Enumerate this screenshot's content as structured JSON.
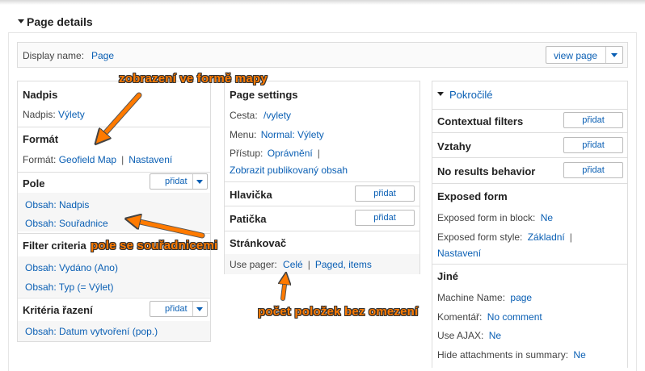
{
  "page_details": {
    "title": "Page details"
  },
  "display": {
    "label": "Display name:",
    "value": "Page",
    "view_page_label": "view page"
  },
  "col1": {
    "nadpis": {
      "head": "Nadpis",
      "label": "Nadpis:",
      "value": "Výlety"
    },
    "format": {
      "head": "Formát",
      "label": "Formát:",
      "value": "Geofield Map",
      "settings": "Nastavení"
    },
    "pole": {
      "head": "Pole",
      "add": "přidat",
      "items": [
        "Obsah: Nadpis",
        "Obsah: Souřadnice"
      ]
    },
    "filter": {
      "head": "Filter criteria",
      "items": [
        "Obsah: Vydáno (Ano)",
        "Obsah: Typ (= Výlet)"
      ]
    },
    "sort": {
      "head": "Kritéria řazení",
      "add": "přidat",
      "items": [
        "Obsah: Datum vytvoření (pop.)"
      ]
    }
  },
  "col2": {
    "settings": {
      "head": "Page settings",
      "path_label": "Cesta:",
      "path_value": "/vylety",
      "menu_label": "Menu:",
      "menu_value": "Normal: Výlety",
      "access_label": "Přístup:",
      "access_value": "Oprávnění",
      "published": "Zobrazit publikovaný obsah"
    },
    "header": {
      "head": "Hlavička",
      "add": "přidat"
    },
    "footer": {
      "head": "Patička",
      "add": "přidat"
    },
    "pager": {
      "head": "Stránkovač",
      "label": "Use pager:",
      "value": "Celé",
      "items": "Paged, items"
    }
  },
  "col3": {
    "advanced": "Pokročilé",
    "contextual": {
      "head": "Contextual filters",
      "add": "přidat"
    },
    "relations": {
      "head": "Vztahy",
      "add": "přidat"
    },
    "noresults": {
      "head": "No results behavior",
      "add": "přidat"
    },
    "exposed": {
      "head": "Exposed form",
      "block_label": "Exposed form in block:",
      "block_value": "Ne",
      "style_label": "Exposed form style:",
      "style_value": "Základní",
      "style_settings": "Nastavení"
    },
    "other": {
      "head": "Jiné",
      "machine_label": "Machine Name:",
      "machine_value": "page",
      "comment_label": "Komentář:",
      "comment_value": "No comment",
      "ajax_label": "Use AJAX:",
      "ajax_value": "Ne",
      "hide_label": "Hide attachments in summary:",
      "hide_value": "Ne"
    }
  },
  "annotations": {
    "map": "zobrazení ve formě mapy",
    "coords": "pole se souřadnicemi",
    "count": "počet položek bez omezení"
  },
  "colors": {
    "link": "#0a5fb4",
    "annotation": "#ff7a00"
  }
}
